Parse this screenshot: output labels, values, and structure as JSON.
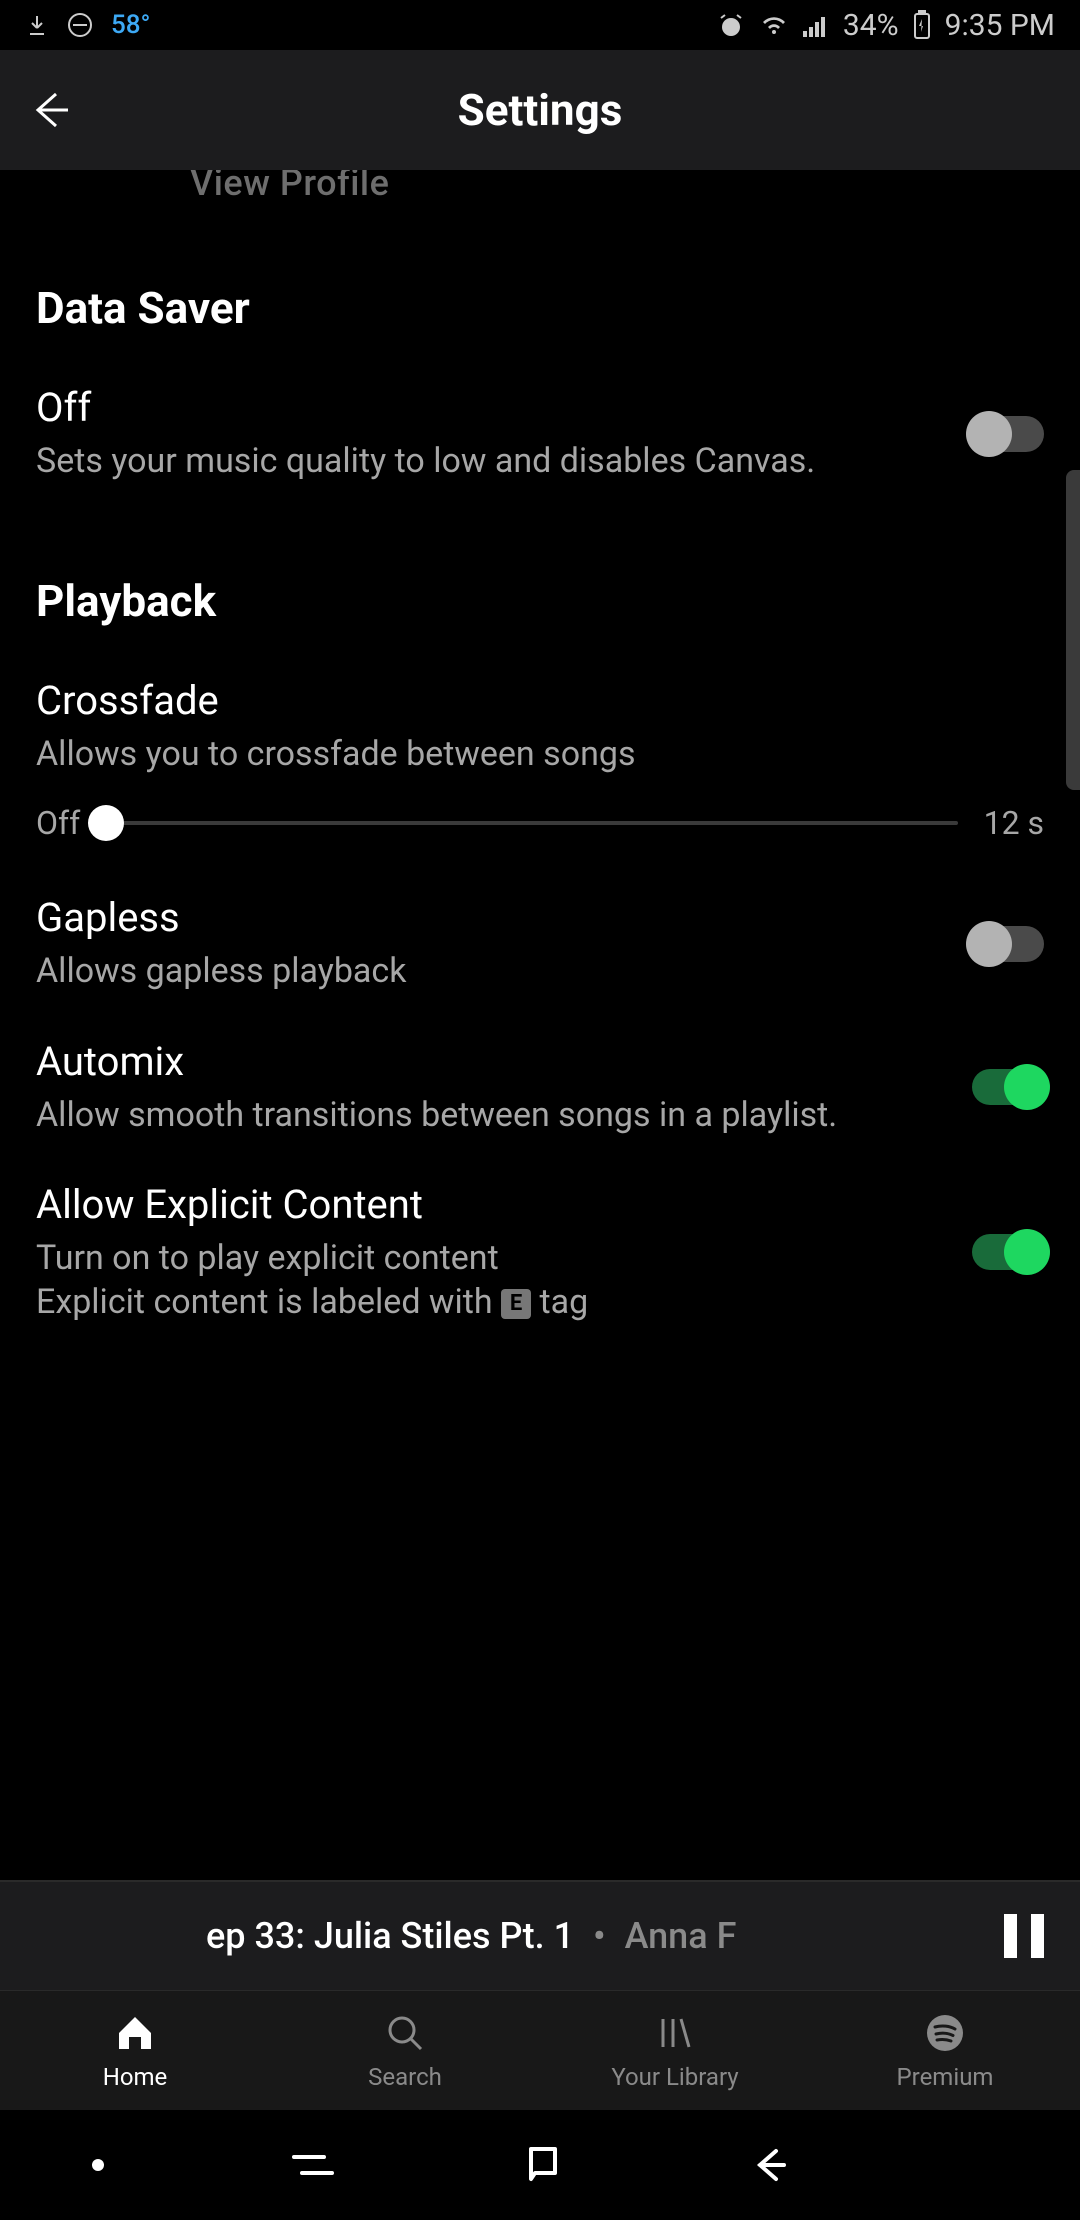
{
  "status": {
    "temp": "58°",
    "battery": "34%",
    "time": "9:35 PM"
  },
  "header": {
    "title": "Settings"
  },
  "profile": {
    "view_profile": "View Profile"
  },
  "sections": {
    "data_saver": {
      "heading": "Data Saver",
      "item": {
        "title": "Off",
        "desc": "Sets your music quality to low and disables Canvas.",
        "on": false
      }
    },
    "playback": {
      "heading": "Playback",
      "crossfade": {
        "title": "Crossfade",
        "desc": "Allows you to crossfade between songs",
        "left": "Off",
        "right": "12 s",
        "value": 0
      },
      "gapless": {
        "title": "Gapless",
        "desc": "Allows gapless playback",
        "on": false
      },
      "automix": {
        "title": "Automix",
        "desc": "Allow smooth transitions between songs in a playlist.",
        "on": true
      },
      "explicit": {
        "title": "Allow Explicit Content",
        "desc_1": "Turn on to play explicit content",
        "desc_2a": "Explicit content is labeled with ",
        "desc_2b": " tag",
        "badge": "E",
        "on": true
      }
    }
  },
  "now_playing": {
    "track": "ep 33: Julia Stiles Pt. 1",
    "sep": "•",
    "artist": "Anna F"
  },
  "nav": {
    "home": "Home",
    "search": "Search",
    "library": "Your Library",
    "premium": "Premium"
  }
}
